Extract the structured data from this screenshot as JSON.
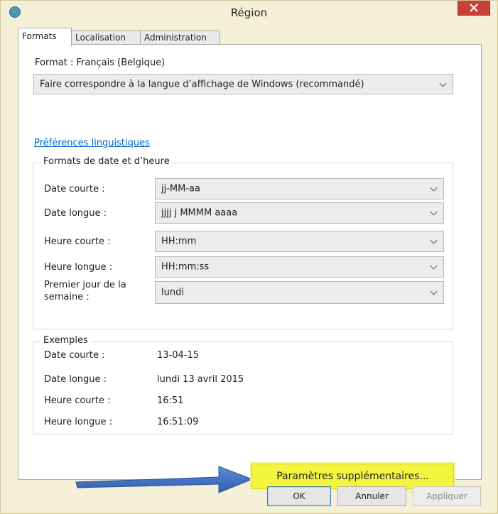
{
  "window": {
    "title": "Région",
    "icon": "globe-icon",
    "close_icon": "close-icon"
  },
  "tabs": [
    {
      "label": "Formats",
      "active": true
    },
    {
      "label": "Localisation",
      "active": false
    },
    {
      "label": "Administration",
      "active": false
    }
  ],
  "format": {
    "label": "Format : Français (Belgique)",
    "selected": "Faire correspondre à la langue d’affichage de Windows (recommandé)"
  },
  "language_prefs_link": "Préférences linguistiques",
  "datetime_formats": {
    "title": "Formats de date et d’heure",
    "rows": [
      {
        "label": "Date courte :",
        "value": "jj-MM-aa"
      },
      {
        "label": "Date longue :",
        "value": "jjjj j MMMM aaaa"
      },
      {
        "label": "Heure courte :",
        "value": "HH:mm"
      },
      {
        "label": "Heure longue :",
        "value": "HH:mm:ss"
      },
      {
        "label": "Premier jour de la semaine :",
        "value": "lundi"
      }
    ]
  },
  "examples": {
    "title": "Exemples",
    "rows": [
      {
        "label": "Date courte :",
        "value": "13-04-15"
      },
      {
        "label": "Date longue :",
        "value": "lundi 13 avril 2015"
      },
      {
        "label": "Heure courte :",
        "value": "16:51"
      },
      {
        "label": "Heure longue :",
        "value": "16:51:09"
      }
    ]
  },
  "advanced_button": "Paramètres supplémentaires...",
  "buttons": {
    "ok": "OK",
    "cancel": "Annuler",
    "apply": "Appliquer"
  },
  "colors": {
    "highlight": "#f4f53f",
    "arrow": "#3f6fc1",
    "close": "#c7403a",
    "link": "#0066cc"
  }
}
